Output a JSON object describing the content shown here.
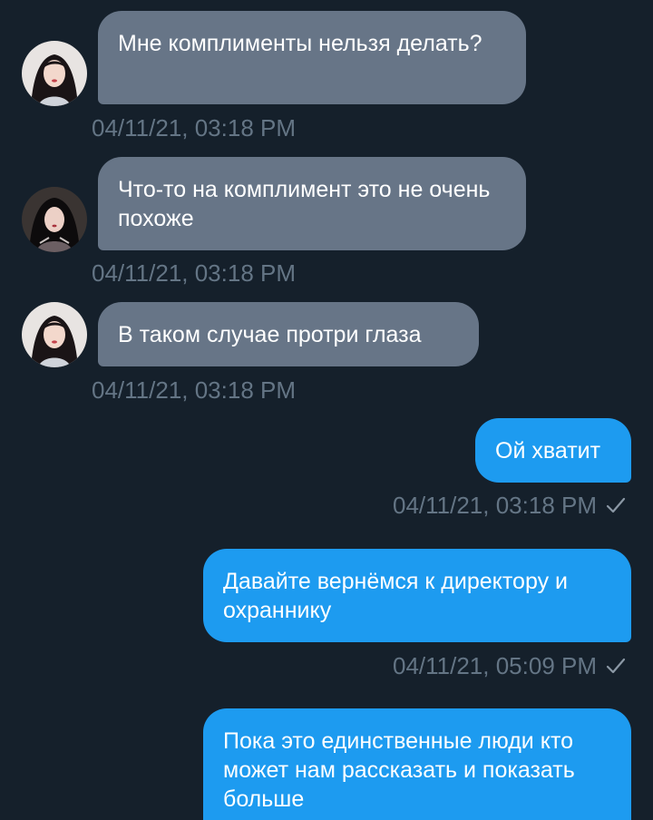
{
  "messages": [
    {
      "direction": "incoming",
      "text": "Мне комплименты нельзя делать?",
      "time": "04/11/21, 03:18 PM",
      "avatar": "avatar-girl-light"
    },
    {
      "direction": "incoming",
      "text": "Что-то на комплимент это не очень похоже",
      "time": "04/11/21, 03:18 PM",
      "avatar": "avatar-girl-dark"
    },
    {
      "direction": "incoming",
      "text": "В таком случае протри глаза",
      "time": "04/11/21, 03:18 PM",
      "avatar": "avatar-girl-light"
    },
    {
      "direction": "outgoing",
      "text": "Ой хватит",
      "time": "04/11/21, 03:18 PM",
      "status_icon": "checkmark-icon"
    },
    {
      "direction": "outgoing",
      "text": "Давайте вернёмся к директору и охраннику",
      "time": "04/11/21, 05:09 PM",
      "status_icon": "checkmark-icon"
    },
    {
      "direction": "outgoing",
      "text": "Пока это единственные люди кто может нам рассказать и показать больше",
      "time": "",
      "status_icon": ""
    }
  ],
  "colors": {
    "background": "#15202b",
    "incoming_bubble": "#677587",
    "outgoing_bubble": "#1d9bf0",
    "timestamp": "#647585",
    "text": "#ffffff"
  }
}
